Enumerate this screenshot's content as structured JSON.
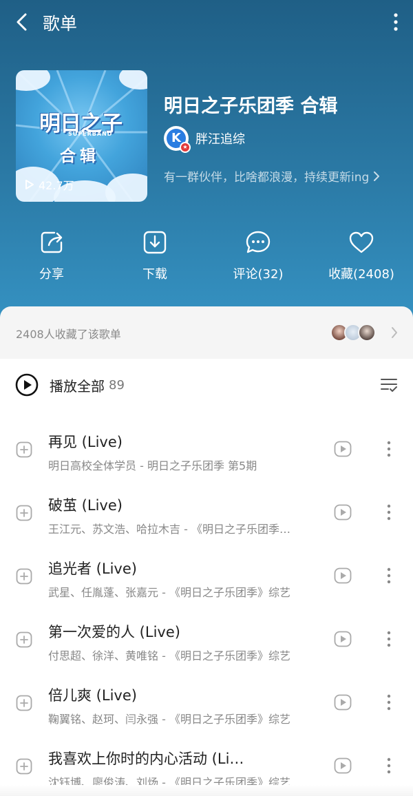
{
  "header": {
    "title": "歌单"
  },
  "playlist": {
    "title": "明日之子乐团季 合辑",
    "cover": {
      "logo_text": "明日之子",
      "sub_text": "SUPERBAND",
      "album_text": "合辑",
      "play_count": "42.7万"
    },
    "creator": {
      "avatar_letter": "K",
      "name": "胖汪追综"
    },
    "description": "有一群伙伴，比啥都浪漫，持续更新ing"
  },
  "actions": [
    {
      "label": "分享",
      "icon": "share-icon"
    },
    {
      "label": "下载",
      "icon": "download-icon"
    },
    {
      "label": "评论(32)",
      "icon": "comment-icon"
    },
    {
      "label": "收藏(2408)",
      "icon": "heart-icon"
    }
  ],
  "collectors": {
    "text": "2408人收藏了该歌单"
  },
  "play_all": {
    "label": "播放全部",
    "count": "89"
  },
  "songs": [
    {
      "title": "再见 (Live)",
      "meta": "明日高校全体学员 - 明日之子乐团季 第5期"
    },
    {
      "title": "破茧 (Live)",
      "meta": "王江元、苏文浩、哈拉木吉 - 《明日之子乐团季…"
    },
    {
      "title": "追光者 (Live)",
      "meta": "武星、任胤蓬、张嘉元 - 《明日之子乐团季》综艺"
    },
    {
      "title": "第一次爱的人 (Live)",
      "meta": "付思超、徐洋、黄唯铭 - 《明日之子乐团季》综艺"
    },
    {
      "title": "倍儿爽 (Live)",
      "meta": "鞠翼铭、赵珂、闫永强 - 《明日之子乐团季》综艺"
    },
    {
      "title": "我喜欢上你时的内心活动 (Li…",
      "meta": "沈钰博、廖俊涛、刘炀 - 《明日之子乐团季》综艺"
    }
  ],
  "colors": {
    "hero_top": "#1f5f86",
    "hero_bottom": "#3592c2",
    "creator_badge": "#2a7de1",
    "creator_star": "#e23a3a"
  }
}
